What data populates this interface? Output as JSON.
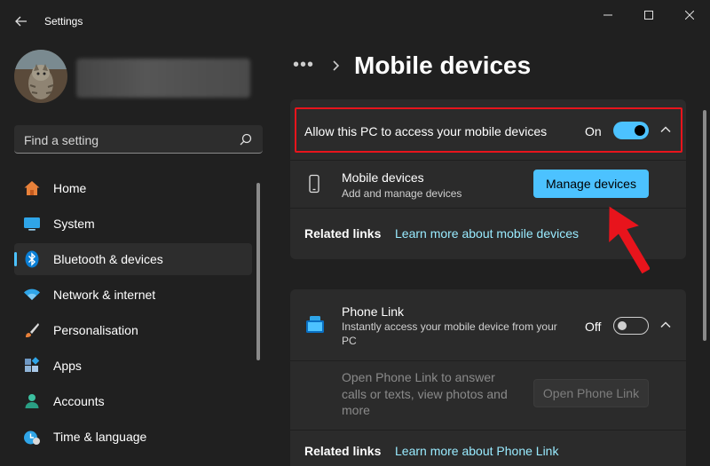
{
  "app": {
    "title": "Settings"
  },
  "search": {
    "placeholder": "Find a setting"
  },
  "sidebar": {
    "items": [
      {
        "label": "Home",
        "icon": "home-icon",
        "selected": false
      },
      {
        "label": "System",
        "icon": "system-icon",
        "selected": false
      },
      {
        "label": "Bluetooth & devices",
        "icon": "bluetooth-icon",
        "selected": true
      },
      {
        "label": "Network & internet",
        "icon": "wifi-icon",
        "selected": false
      },
      {
        "label": "Personalisation",
        "icon": "brush-icon",
        "selected": false
      },
      {
        "label": "Apps",
        "icon": "apps-icon",
        "selected": false
      },
      {
        "label": "Accounts",
        "icon": "account-icon",
        "selected": false
      },
      {
        "label": "Time & language",
        "icon": "time-language-icon",
        "selected": false
      }
    ]
  },
  "header": {
    "title": "Mobile devices"
  },
  "mobile_card": {
    "allow_label": "Allow this PC to access your mobile devices",
    "allow_state": "On",
    "devices_title": "Mobile devices",
    "devices_sub": "Add and manage devices",
    "manage_button": "Manage devices",
    "related_label": "Related links",
    "related_link": "Learn more about mobile devices"
  },
  "phone_card": {
    "title": "Phone Link",
    "sub": "Instantly access your mobile device from your PC",
    "state": "Off",
    "open_desc": "Open Phone Link to answer calls or texts, view photos and more",
    "open_button": "Open Phone Link",
    "related_label": "Related links",
    "related_link": "Learn more about Phone Link"
  },
  "colors": {
    "accent": "#4cc2ff",
    "link": "#99ebff",
    "highlight": "#e8141c",
    "background": "#202020",
    "card": "#2b2b2b"
  }
}
